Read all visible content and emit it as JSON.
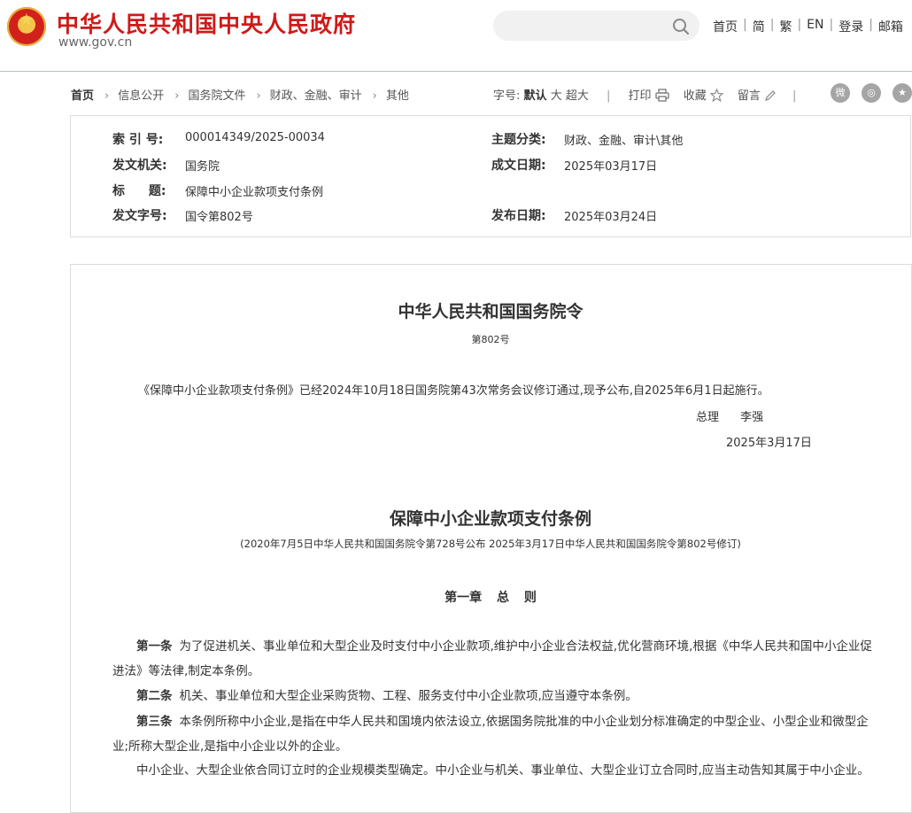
{
  "header": {
    "site_title": "中华人民共和国中央人民政府",
    "site_url": "www.gov.cn",
    "search": {
      "value": "",
      "placeholder": ""
    },
    "nav": [
      "首页",
      "简",
      "繁",
      "EN",
      "登录",
      "邮箱"
    ]
  },
  "breadcrumb": {
    "items": [
      "首页",
      "信息公开",
      "国务院文件",
      "财政、金融、审计",
      "其他"
    ]
  },
  "tools": {
    "font_label": "字号:",
    "font_sizes": [
      "默认",
      "大",
      "超大"
    ],
    "print": "打印",
    "favorite": "收藏",
    "comment": "留言"
  },
  "share": {
    "weibo": "weibo-icon",
    "wechat": "wechat-icon",
    "favorite": "star-icon"
  },
  "meta": {
    "index_label": "索 引 号:",
    "index_value": "000014349/2025-00034",
    "topic_label": "主题分类:",
    "topic_value": "财政、金融、审计\\其他",
    "issuer_label": "发文机关:",
    "issuer_value": "国务院",
    "created_label": "成文日期:",
    "created_value": "2025年03月17日",
    "title_label": "标 题:",
    "title_value": "保障中小企业款项支付条例",
    "docno_label": "发文字号:",
    "docno_value": "国令第802号",
    "published_label": "发布日期:",
    "published_value": "2025年03月24日"
  },
  "article": {
    "order_title": "中华人民共和国国务院令",
    "order_number": "第802号",
    "promulgation": "《保障中小企业款项支付条例》已经2024年10月18日国务院第43次常务会议修订通过,现予公布,自2025年6月1日起施行。",
    "signatory": "总理 李强",
    "sign_date": "2025年3月17日",
    "reg_title": "保障中小企业款项支付条例",
    "reg_subtitle": "(2020年7月5日中华人民共和国国务院令第728号公布 2025年3月17日中华人民共和国国务院令第802号修订)",
    "chapter": "第一章 总 则",
    "paragraphs": [
      {
        "label": "第一条",
        "text": "为了促进机关、事业单位和大型企业及时支付中小企业款项,维护中小企业合法权益,优化营商环境,根据《中华人民共和国中小企业促进法》等法律,制定本条例。"
      },
      {
        "label": "第二条",
        "text": "机关、事业单位和大型企业采购货物、工程、服务支付中小企业款项,应当遵守本条例。"
      },
      {
        "label": "第三条",
        "text": "本条例所称中小企业,是指在中华人民共和国境内依法设立,依据国务院批准的中小企业划分标准确定的中型企业、小型企业和微型企业;所称大型企业,是指中小企业以外的企业。"
      },
      {
        "label": "",
        "text": "中小企业、大型企业依合同订立时的企业规模类型确定。中小企业与机关、事业单位、大型企业订立合同时,应当主动告知其属于中小企业。"
      }
    ]
  }
}
